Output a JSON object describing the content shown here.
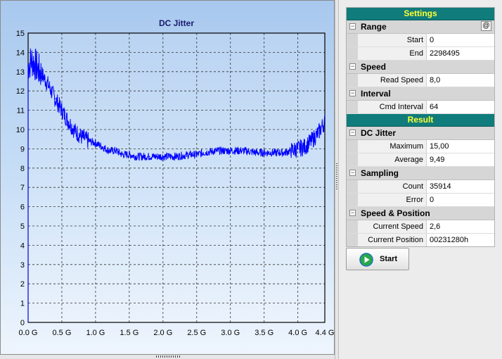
{
  "chart_data": {
    "type": "line",
    "title": "DC Jitter",
    "xlabel": "",
    "ylabel": "",
    "ylim": [
      0,
      15
    ],
    "xlim": [
      0,
      4.4
    ],
    "x_ticks": [
      "0.0 G",
      "0.5 G",
      "1.0 G",
      "1.5 G",
      "2.0 G",
      "2.5 G",
      "3.0 G",
      "3.5 G",
      "4.0 G",
      "4.4 G"
    ],
    "y_ticks": [
      "0",
      "1",
      "2",
      "3",
      "4",
      "5",
      "6",
      "7",
      "8",
      "9",
      "10",
      "11",
      "12",
      "13",
      "14",
      "15"
    ],
    "grid": true,
    "series": [
      {
        "color": "#0000ff",
        "x": [
          0.0,
          0.05,
          0.1,
          0.15,
          0.2,
          0.3,
          0.4,
          0.5,
          0.6,
          0.7,
          0.8,
          0.9,
          1.0,
          1.1,
          1.2,
          1.3,
          1.4,
          1.5,
          1.6,
          1.8,
          2.0,
          2.2,
          2.4,
          2.5,
          2.6,
          2.8,
          3.0,
          3.2,
          3.4,
          3.5,
          3.6,
          3.8,
          3.9,
          4.0,
          4.1,
          4.2,
          4.3,
          4.4
        ],
        "y": [
          13.3,
          13.6,
          13.4,
          13.1,
          12.9,
          12.3,
          11.6,
          11.0,
          10.4,
          9.9,
          9.6,
          9.4,
          9.3,
          9.1,
          8.9,
          8.9,
          8.7,
          8.7,
          8.6,
          8.6,
          8.6,
          8.6,
          8.7,
          8.7,
          8.8,
          8.9,
          8.9,
          8.9,
          8.8,
          8.8,
          8.8,
          8.8,
          8.9,
          9.0,
          9.1,
          9.4,
          9.8,
          10.4
        ]
      }
    ]
  },
  "settings": {
    "header": "Settings",
    "range": {
      "label": "Range",
      "at_button": "@",
      "start_label": "Start",
      "start_value": "0",
      "end_label": "End",
      "end_value": "2298495"
    },
    "speed": {
      "label": "Speed",
      "read_speed_label": "Read Speed",
      "read_speed_value": "8,0"
    },
    "interval": {
      "label": "Interval",
      "cmd_interval_label": "Cmd Interval",
      "cmd_interval_value": "64"
    }
  },
  "result": {
    "header": "Result",
    "dc_jitter": {
      "label": "DC Jitter",
      "maximum_label": "Maximum",
      "maximum_value": "15,00",
      "average_label": "Average",
      "average_value": "9,49"
    },
    "sampling": {
      "label": "Sampling",
      "count_label": "Count",
      "count_value": "35914",
      "error_label": "Error",
      "error_value": "0"
    },
    "speed_position": {
      "label": "Speed & Position",
      "current_speed_label": "Current Speed",
      "current_speed_value": "2,6",
      "current_position_label": "Current Position",
      "current_position_value": "00231280h"
    }
  },
  "start_button": {
    "label": "Start"
  },
  "colors": {
    "accent_header": "#107c7c",
    "header_text": "#ffff33",
    "plot_line": "#0000ff"
  }
}
